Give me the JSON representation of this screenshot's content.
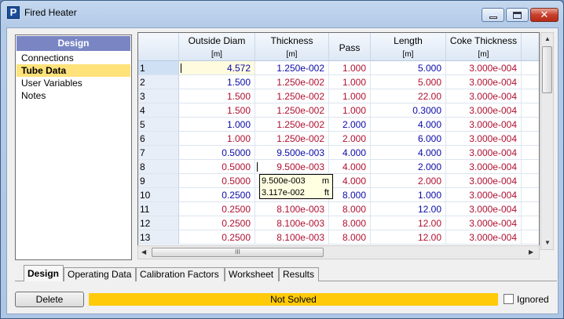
{
  "window": {
    "title": "Fired Heater",
    "app_icon": "P",
    "icons": {
      "minimize": "minimize-icon",
      "maximize": "maximize-icon",
      "close": "close-icon"
    }
  },
  "nav": {
    "header": "Design",
    "items": [
      "Connections",
      "Tube Data",
      "User Variables",
      "Notes"
    ],
    "selected": "Tube Data"
  },
  "grid": {
    "columns": [
      {
        "label": "Outside Diam",
        "unit": "[m]"
      },
      {
        "label": "Thickness",
        "unit": "[m]"
      },
      {
        "label": "Pass",
        "unit": ""
      },
      {
        "label": "Length",
        "unit": "[m]"
      },
      {
        "label": "Coke Thickness",
        "unit": "[m]"
      }
    ],
    "rows": [
      {
        "n": "1",
        "od": "4.572",
        "th": "1.250e-002",
        "pass": "1.000",
        "len": "5.000",
        "coke": "3.000e-004",
        "c": [
          "blue",
          "blue",
          "red",
          "blue",
          "red"
        ]
      },
      {
        "n": "2",
        "od": "1.500",
        "th": "1.250e-002",
        "pass": "1.000",
        "len": "5.000",
        "coke": "3.000e-004",
        "c": [
          "blue",
          "red",
          "red",
          "red",
          "red"
        ]
      },
      {
        "n": "3",
        "od": "1.500",
        "th": "1.250e-002",
        "pass": "1.000",
        "len": "22.00",
        "coke": "3.000e-004",
        "c": [
          "red",
          "red",
          "red",
          "red",
          "red"
        ]
      },
      {
        "n": "4",
        "od": "1.500",
        "th": "1.250e-002",
        "pass": "1.000",
        "len": "0.3000",
        "coke": "3.000e-004",
        "c": [
          "red",
          "red",
          "red",
          "blue",
          "red"
        ]
      },
      {
        "n": "5",
        "od": "1.000",
        "th": "1.250e-002",
        "pass": "2.000",
        "len": "4.000",
        "coke": "3.000e-004",
        "c": [
          "blue",
          "red",
          "blue",
          "blue",
          "red"
        ]
      },
      {
        "n": "6",
        "od": "1.000",
        "th": "1.250e-002",
        "pass": "2.000",
        "len": "6.000",
        "coke": "3.000e-004",
        "c": [
          "red",
          "red",
          "red",
          "blue",
          "red"
        ]
      },
      {
        "n": "7",
        "od": "0.5000",
        "th": "9.500e-003",
        "pass": "4.000",
        "len": "4.000",
        "coke": "3.000e-004",
        "c": [
          "blue",
          "blue",
          "blue",
          "blue",
          "red"
        ]
      },
      {
        "n": "8",
        "od": "0.5000",
        "th": "9.500e-003",
        "pass": "4.000",
        "len": "2.000",
        "coke": "3.000e-004",
        "c": [
          "red",
          "red",
          "red",
          "blue",
          "red"
        ]
      },
      {
        "n": "9",
        "od": "0.5000",
        "th": "9.500e-003",
        "pass": "4.000",
        "len": "2.000",
        "coke": "3.000e-004",
        "c": [
          "red",
          "red",
          "red",
          "red",
          "red"
        ]
      },
      {
        "n": "10",
        "od": "0.2500",
        "th": "9.500e-003",
        "pass": "8.000",
        "len": "1.000",
        "coke": "3.000e-004",
        "c": [
          "blue",
          "blue",
          "blue",
          "blue",
          "red"
        ]
      },
      {
        "n": "11",
        "od": "0.2500",
        "th": "8.100e-003",
        "pass": "8.000",
        "len": "12.00",
        "coke": "3.000e-004",
        "c": [
          "red",
          "red",
          "red",
          "blue",
          "red"
        ]
      },
      {
        "n": "12",
        "od": "0.2500",
        "th": "8.100e-003",
        "pass": "8.000",
        "len": "12.00",
        "coke": "3.000e-004",
        "c": [
          "red",
          "red",
          "red",
          "red",
          "red"
        ]
      },
      {
        "n": "13",
        "od": "0.2500",
        "th": "8.100e-003",
        "pass": "8.000",
        "len": "12.00",
        "coke": "3.000e-004",
        "c": [
          "red",
          "red",
          "red",
          "red",
          "red"
        ]
      }
    ]
  },
  "tooltip": {
    "line1_value": "9.500e-003",
    "line1_unit": "m",
    "line2_value": "3.117e-002",
    "line2_unit": "ft"
  },
  "scroll": {
    "grip": "III"
  },
  "tabs": [
    "Design",
    "Operating Data",
    "Calibration Factors",
    "Worksheet",
    "Results"
  ],
  "active_tab": "Design",
  "footer": {
    "delete_label": "Delete",
    "status_text": "Not Solved",
    "status_color": "#ffca08",
    "ignored_label": "Ignored",
    "ignored_checked": false
  }
}
